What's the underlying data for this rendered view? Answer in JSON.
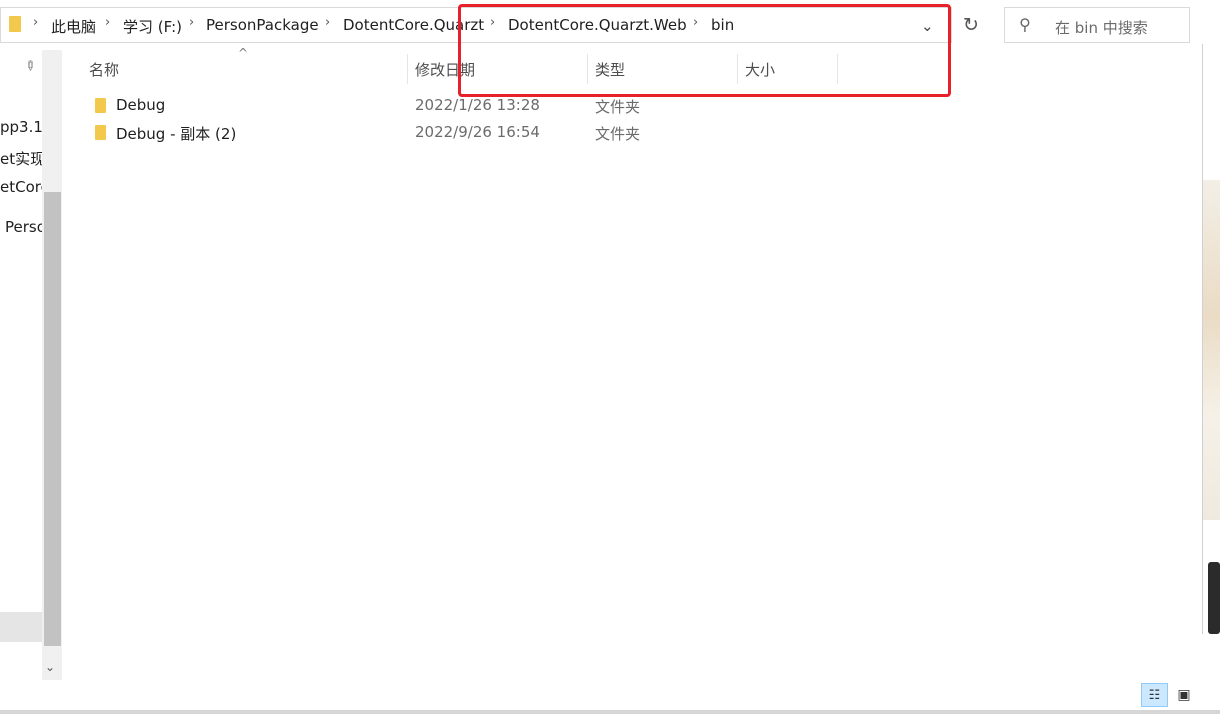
{
  "address_bar": {
    "crumbs": [
      "此电脑",
      "学习 (F:)",
      "PersonPackage",
      "DotentCore.Quarzt",
      "DotentCore.Quarzt.Web",
      "bin"
    ],
    "separator": "›",
    "dropdown_glyph": "⌄"
  },
  "refresh": {
    "glyph": "↻"
  },
  "search": {
    "placeholder": "在 bin 中搜索",
    "icon": "search-icon"
  },
  "nav_pane": {
    "pin_glyph": "📌",
    "items": [
      "pp3.1",
      "et实现",
      "etCore",
      "Perso"
    ]
  },
  "columns": {
    "name": "名称",
    "date_modified": "修改日期",
    "type": "类型",
    "size": "大小",
    "sort_glyph": "^"
  },
  "files": [
    {
      "name": "Debug",
      "date": "2022/1/26 13:28",
      "type": "文件夹"
    },
    {
      "name": "Debug - 副本 (2)",
      "date": "2022/9/26 16:54",
      "type": "文件夹"
    }
  ],
  "status_bar": {
    "details_glyph": "☷",
    "thumbnail_glyph": "▣"
  },
  "colors": {
    "highlight": "#e8202a",
    "folder": "#f2c94c",
    "selected_view": "#cce8ff"
  }
}
